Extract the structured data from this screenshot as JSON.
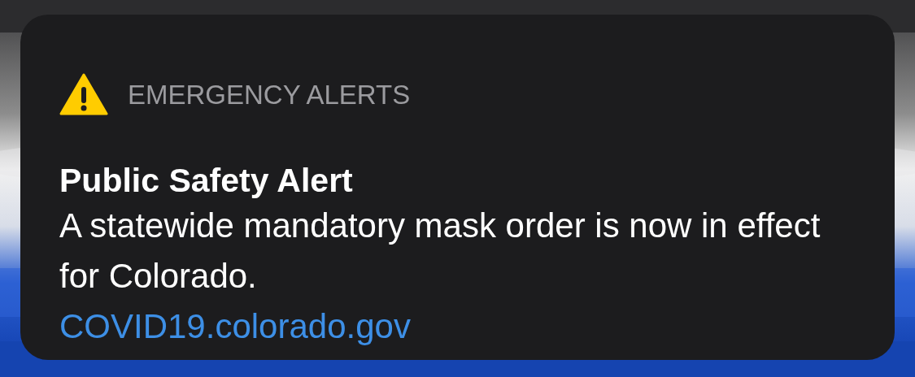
{
  "notification": {
    "app": "EMERGENCY ALERTS",
    "title": "Public Safety Alert",
    "body": "A statewide mandatory mask order is now in effect for Colorado.",
    "link": "COVID19.colorado.gov"
  }
}
